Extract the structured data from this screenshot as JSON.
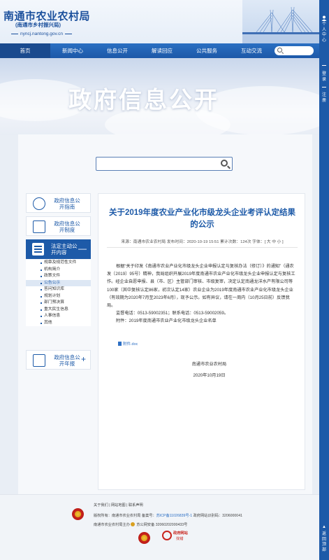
{
  "header": {
    "title": "南通市农业农村局",
    "subtitle": "(南通市乡村振兴局)",
    "url": "nyncj.nantong.gov.cn"
  },
  "nav": {
    "items": [
      "首页",
      "新闻中心",
      "信息公开",
      "解读回应",
      "公共服务",
      "互动交流"
    ]
  },
  "banner": {
    "title": "政府信息公开"
  },
  "right_bar": {
    "personal_center": "个人中心",
    "login": "登录",
    "register": "注册",
    "back_top": "返回顶部"
  },
  "left_menu": {
    "guide": "政府信息公开指南",
    "system": "政府信息公开制度",
    "active": "法定主动公开内容",
    "active_toggle": "—",
    "annual": "政府信息公开年报",
    "annual_toggle": "+",
    "sub_items": [
      "规章及规范性文件",
      "机构简介",
      "政策文件",
      "公告公示",
      "答问知识库",
      "规划计划",
      "部门预决算",
      "重大民生信息",
      "人事信息",
      "其他"
    ],
    "current_sub": "公告公示"
  },
  "article": {
    "title": "关于2019年度农业产业化市级龙头企业考评认定结果的公示",
    "meta": "来源：南通市农业农村局  发布时间：2020-10-19 15:51  累计次数：124次  字体：[ 大 中 小 ]",
    "para1": "根据“关于印发《南通市农业产业化市级龙头企业申报认定与复核办法（修订）》的通知”（通农发〔2019〕95号）精神，我局组织开展2019年度南通市农业产业化市级龙头企业申报认定与复核工作。经企业自愿申报、县（市、区）主管部门审核、市级复审，决定认定南通龙洋水产有限公司等100家（其中复核认定86家，初次认定14家）农业企业为2019年度南通市农业产业化市级龙头企业（有效期为2020年7月至2023年6月），现予公示。如有异议，请在一周内（10月25日前）反馈我局。",
    "para2": "监督电话：0513-59002351；联系电话：0513-59002059。",
    "para3": "附件：2019年度南通市农业产业化市级龙头企业名单",
    "attachment": "附件.doc",
    "sign_org": "南通市农业农村局",
    "sign_date": "2020年10月19日"
  },
  "footer": {
    "links": "关于我们 | 网站地图 | 联系声明",
    "owner": "版权所有：南通市农业农村局  备案号：",
    "icp": "苏ICP备11026839号-1",
    "site_code": "  政府网站识别码：3206000041",
    "host": "南通市农业农村局主办",
    "police": "苏公网安备 32060202000433号",
    "badge_line1": "政府网站",
    "badge_line2": "找错"
  },
  "colors": {
    "brand": "#1d5aa8",
    "accent": "#2a6fc2",
    "link": "#2d6fc4",
    "alert": "#c8231c"
  }
}
